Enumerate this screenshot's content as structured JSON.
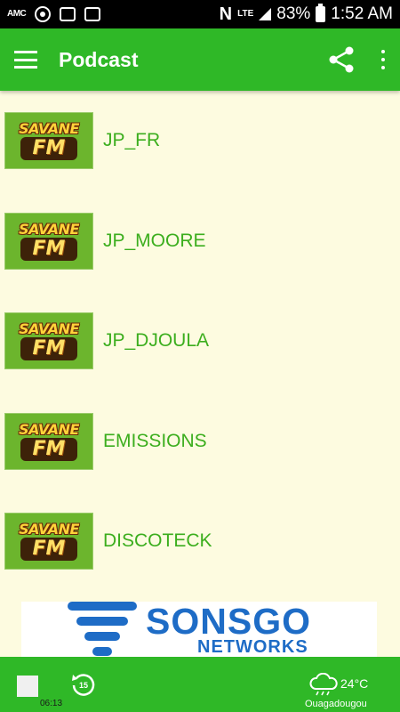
{
  "status_bar": {
    "battery": "83%",
    "time": "1:52 AM",
    "network": "LTE",
    "n_label": "N",
    "small_label": "AMC"
  },
  "app_bar": {
    "title": "Podcast"
  },
  "podcasts": [
    {
      "label": "JP_FR",
      "logo_top": "SAVANE",
      "logo_bottom": "FM"
    },
    {
      "label": "JP_MOORE",
      "logo_top": "SAVANE",
      "logo_bottom": "FM"
    },
    {
      "label": "JP_DJOULA",
      "logo_top": "SAVANE",
      "logo_bottom": "FM"
    },
    {
      "label": "EMISSIONS",
      "logo_top": "SAVANE",
      "logo_bottom": "FM"
    },
    {
      "label": "DISCOTECK",
      "logo_top": "SAVANE",
      "logo_bottom": "FM"
    }
  ],
  "ad": {
    "name": "SONSGO",
    "subtitle": "NETWORKS"
  },
  "player": {
    "elapsed": "06:13",
    "replay_seconds": "15",
    "temperature": "24°C",
    "city": "Ouagadougou"
  },
  "colors": {
    "primary": "#2fb827",
    "label": "#3cae1e",
    "background": "#fdfbe0",
    "ad_blue": "#1e6cc6"
  }
}
